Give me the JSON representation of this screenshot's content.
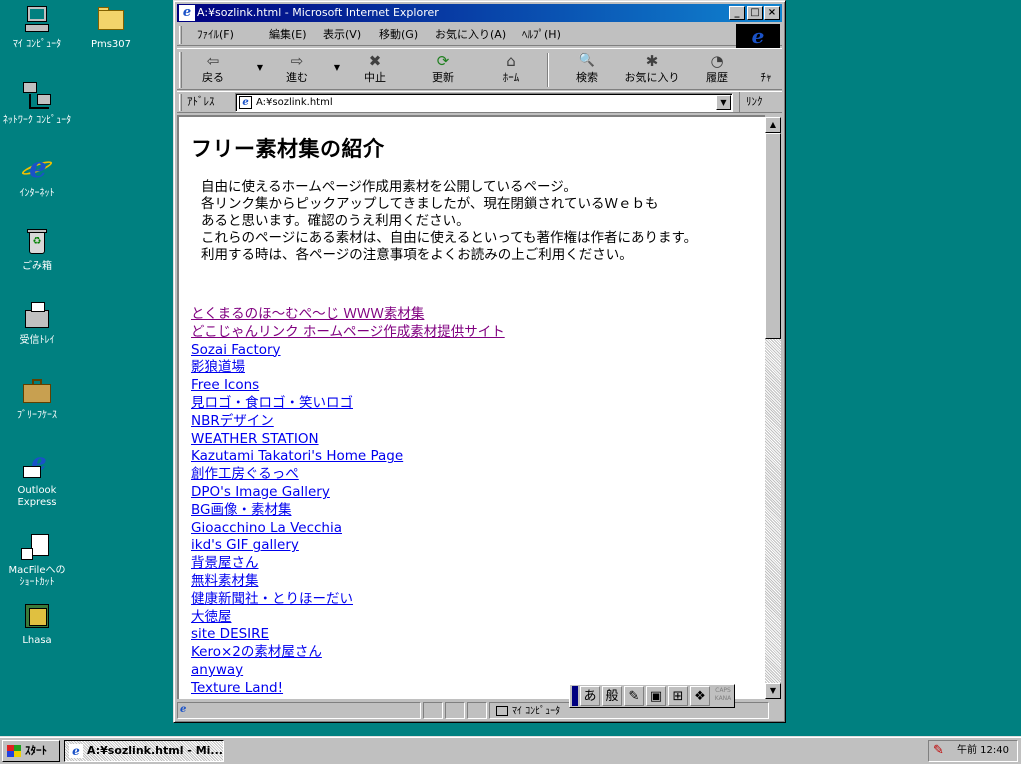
{
  "desktop": {
    "icons": [
      {
        "label": "ﾏｲ ｺﾝﾋﾟｭｰﾀ",
        "icon": "my-computer-icon"
      },
      {
        "label": "Pms307",
        "icon": "folder-icon"
      },
      {
        "label": "ﾈｯﾄﾜｰｸ ｺﾝﾋﾟｭｰﾀ",
        "icon": "network-computer-icon"
      },
      {
        "label": "ｲﾝﾀｰﾈｯﾄ",
        "icon": "internet-explorer-icon"
      },
      {
        "label": "ごみ箱",
        "icon": "recycle-bin-icon"
      },
      {
        "label": "受信ﾄﾚｲ",
        "icon": "inbox-icon"
      },
      {
        "label": "ﾌﾞﾘｰﾌｹｰｽ",
        "icon": "briefcase-icon"
      },
      {
        "label": "Outlook Express",
        "icon": "outlook-express-icon"
      },
      {
        "label": "MacFileへの ｼｮｰﾄｶｯﾄ",
        "icon": "macfile-shortcut-icon"
      },
      {
        "label": "Lhasa",
        "icon": "lhasa-icon"
      }
    ]
  },
  "window": {
    "title": "A:¥sozlink.html - Microsoft Internet Explorer",
    "controls": {
      "minimize": "_",
      "maximize": "□",
      "close": "×"
    },
    "menu": [
      "ﾌｧｲﾙ(F)",
      "編集(E)",
      "表示(V)",
      "移動(G)",
      "お気に入り(A)",
      "ﾍﾙﾌﾟ(H)"
    ],
    "toolbar": [
      {
        "label": "戻る",
        "icon": "back-arrow-icon",
        "glyph": "⇦"
      },
      {
        "label": "進む",
        "icon": "forward-arrow-icon",
        "glyph": "⇨"
      },
      {
        "label": "中止",
        "icon": "stop-icon",
        "glyph": "✖"
      },
      {
        "label": "更新",
        "icon": "refresh-icon",
        "glyph": "⟳"
      },
      {
        "label": "ﾎｰﾑ",
        "icon": "home-icon",
        "glyph": "⌂"
      },
      {
        "label": "検索",
        "icon": "search-icon",
        "glyph": "🔍"
      },
      {
        "label": "お気に入り",
        "icon": "favorites-icon",
        "glyph": "✱"
      },
      {
        "label": "履歴",
        "icon": "history-icon",
        "glyph": "◔"
      },
      {
        "label": "ﾁｬ",
        "icon": "channels-icon",
        "glyph": ""
      }
    ],
    "address": {
      "label": "ｱﾄﾞﾚｽ",
      "value": "A:¥sozlink.html",
      "links_label": "ﾘﾝｸ"
    },
    "status": {
      "zone": "ﾏｲ ｺﾝﾋﾟｭｰﾀ"
    }
  },
  "page": {
    "heading": "フリー素材集の紹介",
    "intro": [
      "自由に使えるホームページ作成用素材を公開しているページ。",
      "各リンク集からピックアップしてきましたが、現在閉鎖されているＷｅｂも",
      "あると思います。確認のうえ利用ください。",
      "これらのページにある素材は、自由に使えるといっても著作権は作者にあります。",
      "利用する時は、各ページの注意事項をよくお読みの上ご利用ください。"
    ],
    "links": [
      {
        "text": "とくまるのほ～むぺ～じ ＷＷＷ素材集",
        "visited": true
      },
      {
        "text": "どこじゃんリンク ホームページ作成素材提供サイト",
        "visited": true
      },
      {
        "text": "Sozai Factory",
        "visited": false
      },
      {
        "text": "影狼道場",
        "visited": false
      },
      {
        "text": "Free Icons",
        "visited": false
      },
      {
        "text": "見ロゴ・食ロゴ・笑いロゴ",
        "visited": false
      },
      {
        "text": "NBRデザイン",
        "visited": false
      },
      {
        "text": "WEATHER STATION",
        "visited": false
      },
      {
        "text": "Kazutami Takatori's Home Page",
        "visited": false
      },
      {
        "text": "創作工房ぐるっぺ",
        "visited": false
      },
      {
        "text": "DPO's Image Gallery",
        "visited": false
      },
      {
        "text": "BG画像・素材集",
        "visited": false
      },
      {
        "text": "Gioacchino La Vecchia",
        "visited": false
      },
      {
        "text": "ikd's GIF gallery",
        "visited": false
      },
      {
        "text": "背景屋さん",
        "visited": false
      },
      {
        "text": "無料素材集",
        "visited": false
      },
      {
        "text": "健康新聞社・とりほーだい",
        "visited": false
      },
      {
        "text": "大徳屋",
        "visited": false
      },
      {
        "text": "site DESIRE",
        "visited": false
      },
      {
        "text": "Kero×2の素材屋さん",
        "visited": false
      },
      {
        "text": "anyway",
        "visited": false
      },
      {
        "text": "Texture Land!",
        "visited": false
      }
    ]
  },
  "ime": {
    "buttons": [
      "あ",
      "般",
      "✎",
      "▣",
      "⊞",
      "❖"
    ],
    "caps": "CAPS",
    "kana": "KANA"
  },
  "taskbar": {
    "start_label": "ｽﾀｰﾄ",
    "task": "A:¥sozlink.html - Mi...",
    "clock": "午前 12:40"
  },
  "colors": {
    "desktop": "#008080",
    "title_active": "#000080",
    "link": "#0000ee",
    "visited": "#800080"
  }
}
